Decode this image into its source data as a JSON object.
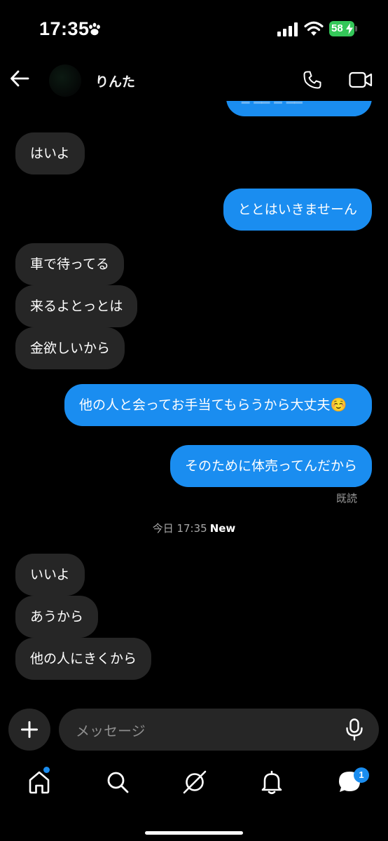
{
  "status_bar": {
    "time": "17:35",
    "battery": "58"
  },
  "header": {
    "contact_name": "りんた"
  },
  "messages": [
    {
      "side": "in",
      "text": "はいよ"
    },
    {
      "side": "out",
      "text": "ととはいきませーん"
    },
    {
      "side": "in",
      "text": "車で待ってる"
    },
    {
      "side": "in",
      "text": "来るよとっとは"
    },
    {
      "side": "in",
      "text": "金欲しいから"
    },
    {
      "side": "out",
      "text": "他の人と会ってお手当てもらうから大丈夫☺️"
    },
    {
      "side": "out",
      "text": "そのために体売ってんだから"
    },
    {
      "side": "in",
      "text": "いいよ"
    },
    {
      "side": "in",
      "text": "あうから"
    },
    {
      "side": "in",
      "text": "他の人にきくから"
    }
  ],
  "read_receipt": "既読",
  "divider": {
    "text": "今日 17:35",
    "new_label": "New"
  },
  "input": {
    "placeholder": "メッセージ"
  },
  "nav": {
    "messages_badge": "1"
  },
  "colors": {
    "outgoing_bubble": "#1a8df0",
    "incoming_bubble": "#262626",
    "background": "#000000",
    "battery": "#34c759"
  }
}
